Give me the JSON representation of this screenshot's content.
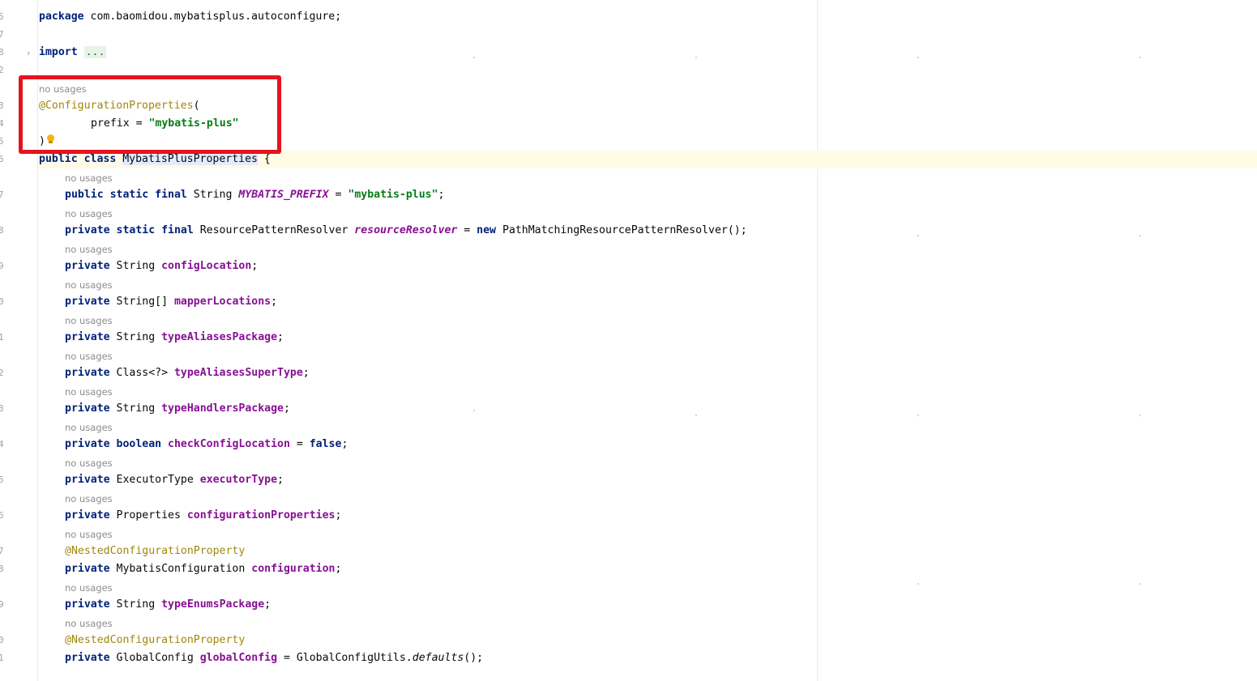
{
  "line_numbers": [
    "5",
    "7",
    "8",
    "2",
    "3",
    "4",
    "5",
    "6",
    "7",
    "8",
    "9",
    "0",
    "1",
    "2",
    "3",
    "4",
    "5",
    "6",
    "7",
    "8",
    "9",
    "0",
    "1"
  ],
  "fold_marker": "›",
  "package_line": {
    "keyword": "package",
    "name": " com.baomidou.mybatisplus.autoconfigure;"
  },
  "import_line": {
    "keyword": "import",
    "folded": "..."
  },
  "usage_hint": "no usages",
  "class_annotation": {
    "name": "@ConfigurationProperties",
    "open": "(",
    "param": "prefix",
    "eq": " = ",
    "value": "\"mybatis-plus\"",
    "close": ")"
  },
  "class_decl": {
    "mods": "public class",
    "name": "MybatisPlusProperties",
    "brace": " {"
  },
  "nested_annotation": "@NestedConfigurationProperty",
  "fields": [
    {
      "mods": "public static final",
      "type": " String ",
      "name": "MYBATIS_PREFIX",
      "rest": " = ",
      "str": "\"mybatis-plus\"",
      "end": ";"
    },
    {
      "mods": "private static final",
      "type": " ResourcePatternResolver ",
      "name": "resourceResolver",
      "rest": " = ",
      "kw2": "new",
      "end": " PathMatchingResourcePatternResolver();"
    },
    {
      "mods": "private",
      "type": " String ",
      "name": "configLocation",
      "end": ";"
    },
    {
      "mods": "private",
      "type": " String[] ",
      "name": "mapperLocations",
      "end": ";"
    },
    {
      "mods": "private",
      "type": " String ",
      "name": "typeAliasesPackage",
      "end": ";"
    },
    {
      "mods": "private",
      "type": " Class<?> ",
      "name": "typeAliasesSuperType",
      "end": ";"
    },
    {
      "mods": "private",
      "type": " String ",
      "name": "typeHandlersPackage",
      "end": ";"
    },
    {
      "mods": "private boolean",
      "type": " ",
      "name": "checkConfigLocation",
      "rest": " = ",
      "kw2": "false",
      "end": ";"
    },
    {
      "mods": "private",
      "type": " ExecutorType ",
      "name": "executorType",
      "end": ";"
    },
    {
      "mods": "private",
      "type": " Properties ",
      "name": "configurationProperties",
      "end": ";"
    },
    {
      "mods": "private",
      "type": " MybatisConfiguration ",
      "name": "configuration",
      "end": ";"
    },
    {
      "mods": "private",
      "type": " String ",
      "name": "typeEnumsPackage",
      "end": ";"
    },
    {
      "mods": "private",
      "type": " GlobalConfig ",
      "name": "globalConfig",
      "rest": " = GlobalConfigUtils.",
      "mth": "defaults",
      "end": "();"
    }
  ]
}
